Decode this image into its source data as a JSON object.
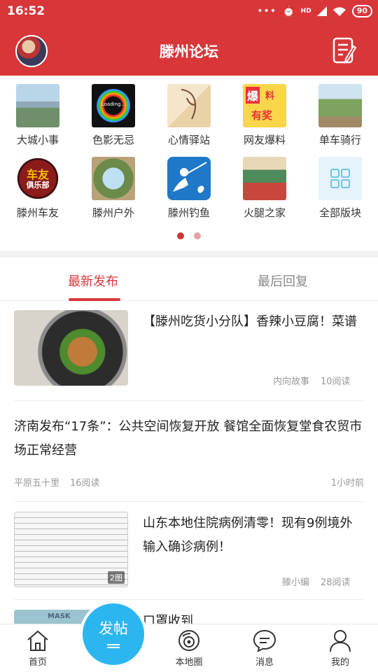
{
  "status_bar": {
    "time": "16:52",
    "signal": "HD",
    "battery": "90"
  },
  "header": {
    "title": "滕州论坛"
  },
  "categories": [
    {
      "label": "大城小事",
      "icon": "city-icon"
    },
    {
      "label": "色影无忌",
      "icon": "camera-lens-icon"
    },
    {
      "label": "心情驿站",
      "icon": "mood-icon"
    },
    {
      "label": "网友爆料",
      "icon": "news-tip-icon"
    },
    {
      "label": "单车骑行",
      "icon": "bicycle-icon"
    },
    {
      "label": "滕州车友",
      "icon": "car-club-icon"
    },
    {
      "label": "滕州户外",
      "icon": "outdoor-icon"
    },
    {
      "label": "滕州钓鱼",
      "icon": "fishing-icon"
    },
    {
      "label": "火腿之家",
      "icon": "radio-icon"
    },
    {
      "label": "全部版块",
      "icon": "grid-icon"
    }
  ],
  "tile_text": {
    "loading": "Loading...",
    "bao": "爆",
    "liao": "料",
    "youjiang": "有奖",
    "cheyou": "车友",
    "julebu": "俱乐部"
  },
  "tabs": {
    "active": "最新发布",
    "inactive": "最后回复"
  },
  "posts": [
    {
      "title": "【滕州吃货小分队】香辣小豆腐！菜谱",
      "author": "内向故事",
      "reads": "10阅读",
      "thumb": "tofu-dish-photo"
    },
    {
      "title": "济南发布“17条”：公共空间恢复开放 餐馆全面恢复堂食农贸市场正常经营",
      "author": "平原五十里",
      "reads": "16阅读",
      "time": "1小时前"
    },
    {
      "title": "山东本地住院病例清零！现有9例境外输入确诊病例！",
      "author": "滕小编",
      "reads": "28阅读",
      "badge": "2图",
      "thumb": "table-screenshot"
    },
    {
      "title": "口罩收到",
      "thumb_text": "MASK"
    }
  ],
  "fab": {
    "label": "发帖"
  },
  "bottom_nav": [
    {
      "label": "首页",
      "icon": "home-icon"
    },
    {
      "label": "本地圈",
      "icon": "local-circle-icon"
    },
    {
      "label": "消息",
      "icon": "message-icon"
    },
    {
      "label": "我的",
      "icon": "profile-icon"
    }
  ],
  "colors": {
    "brand_red": "#d9363a",
    "fab_blue": "#2cb6ef"
  }
}
